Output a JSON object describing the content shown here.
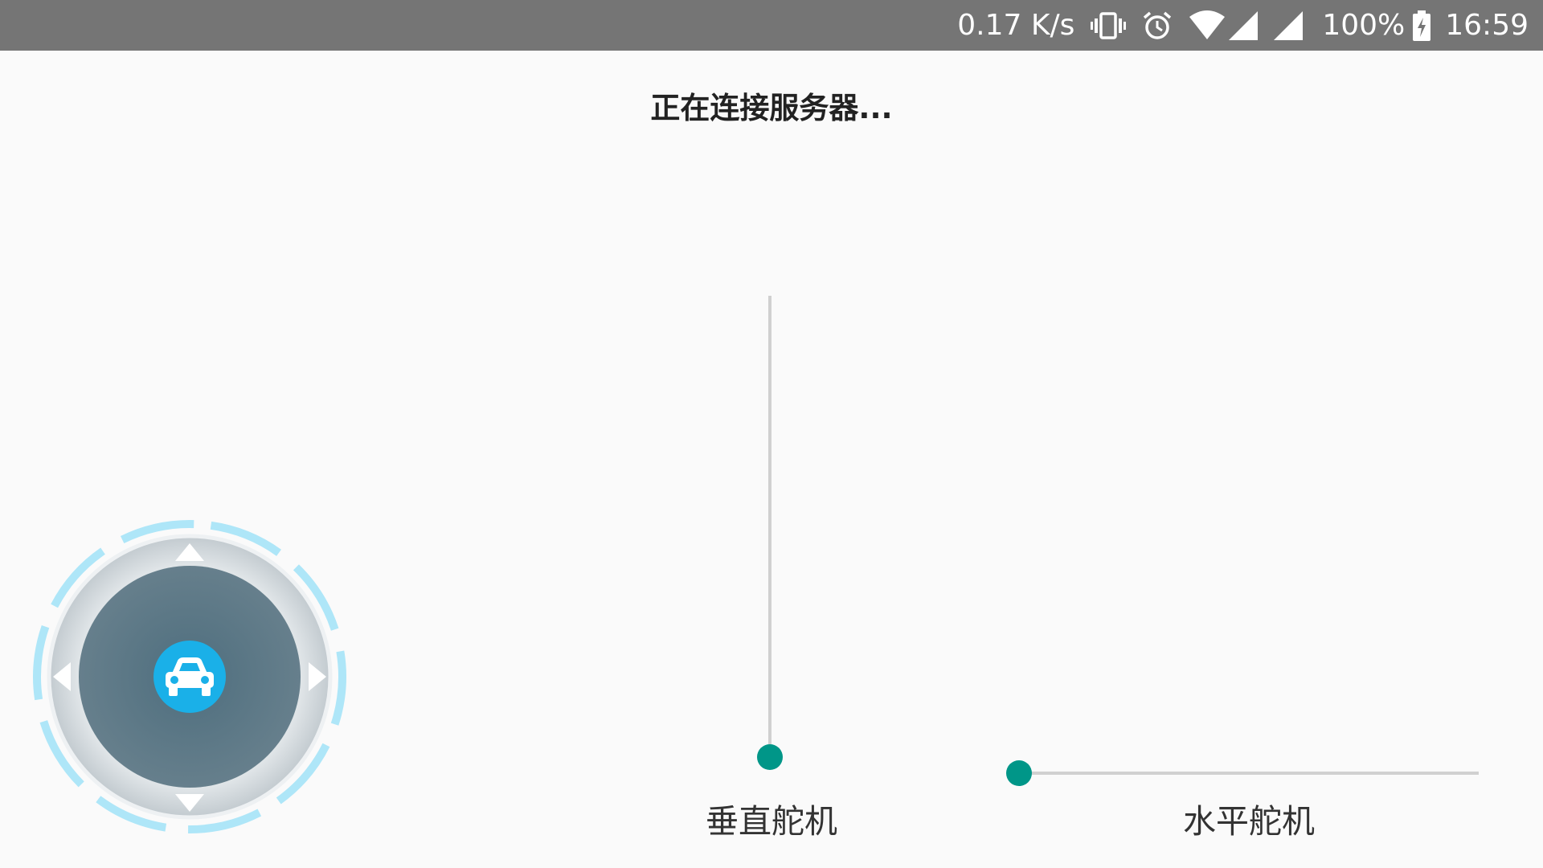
{
  "status_bar": {
    "net_speed": "0.17 K/s",
    "battery": "100%",
    "time": "16:59",
    "icons": [
      "vibrate-icon",
      "alarm-icon",
      "wifi-icon",
      "signal-icon",
      "signal-icon",
      "battery-charging-icon"
    ]
  },
  "title": "正在连接服务器...",
  "joystick": {
    "center_icon": "car-icon",
    "direction_icons": [
      "arrow-up-icon",
      "arrow-right-icon",
      "arrow-down-icon",
      "arrow-left-icon"
    ],
    "colors": {
      "ring": "#aee6f8",
      "pad": "#607d8b",
      "center": "#1ab0e8"
    }
  },
  "vertical_servo": {
    "label": "垂直舵机",
    "value_fraction": 0.0
  },
  "horizontal_servo": {
    "label": "水平舵机",
    "value_fraction": 0.0
  },
  "colors": {
    "accent": "#009688",
    "status_bar": "#757575",
    "background": "#fafafa"
  }
}
